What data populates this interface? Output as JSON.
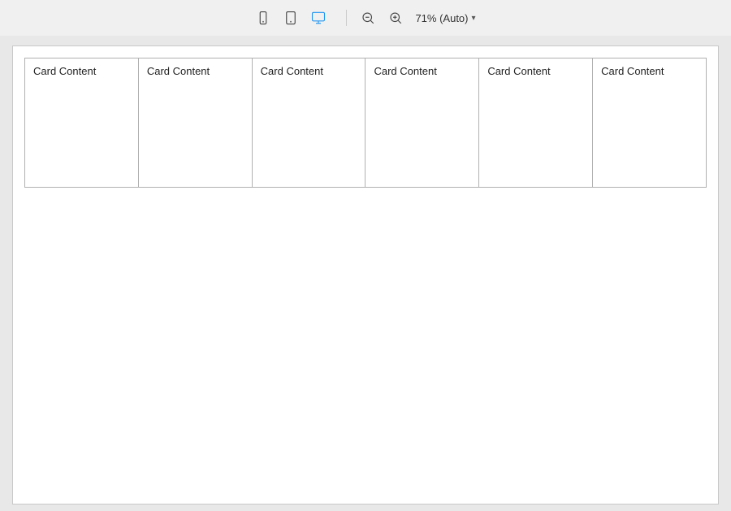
{
  "toolbar": {
    "device_buttons": [
      {
        "id": "mobile",
        "label": "Mobile",
        "icon": "mobile-icon",
        "active": false
      },
      {
        "id": "tablet",
        "label": "Tablet",
        "icon": "tablet-icon",
        "active": false
      },
      {
        "id": "desktop",
        "label": "Desktop",
        "icon": "desktop-icon",
        "active": true
      }
    ],
    "zoom_out_label": "−",
    "zoom_in_label": "+",
    "zoom_value": "71% (Auto)",
    "zoom_arrow": "▾"
  },
  "canvas": {
    "cards": [
      {
        "id": 1,
        "label": "Card Content"
      },
      {
        "id": 2,
        "label": "Card Content"
      },
      {
        "id": 3,
        "label": "Card Content"
      },
      {
        "id": 4,
        "label": "Card Content"
      },
      {
        "id": 5,
        "label": "Card Content"
      },
      {
        "id": 6,
        "label": "Card Content"
      }
    ]
  }
}
